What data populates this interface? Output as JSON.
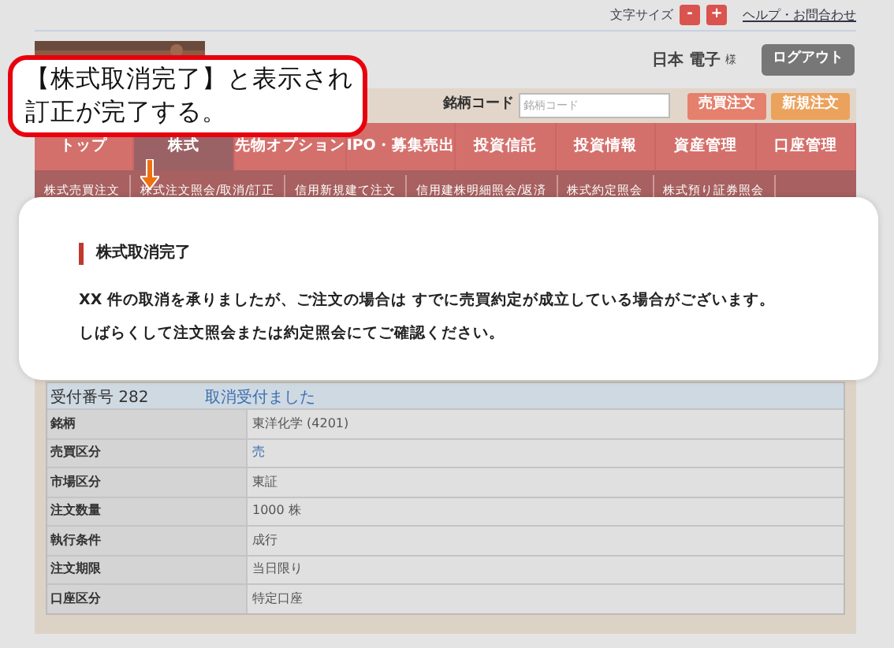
{
  "top_bar": {
    "font_size_label": "文字サイズ",
    "font_buttons": [
      "-",
      "+"
    ],
    "help_link": "ヘルプ・お問合わせ"
  },
  "header": {
    "user_name": "日本 電子",
    "honorific": "様",
    "logout": "ログアウト"
  },
  "search": {
    "label": "銘柄コード",
    "placeholder": "銘柄コード",
    "buttons": [
      {
        "label": "売買注文",
        "color": "#e5806c"
      },
      {
        "label": "新規注文",
        "color": "#eba25c"
      }
    ]
  },
  "nav_tabs": [
    {
      "label": "トップ",
      "selected": false
    },
    {
      "label": "株式",
      "selected": true
    },
    {
      "label": "先物オプション",
      "selected": false
    },
    {
      "label": "IPO・募集売出",
      "selected": false
    },
    {
      "label": "投資信託",
      "selected": false
    },
    {
      "label": "投資情報",
      "selected": false
    },
    {
      "label": "資産管理",
      "selected": false
    },
    {
      "label": "口座管理",
      "selected": false
    }
  ],
  "sub_nav": [
    "株式売買注文",
    "株式注文照会/取消/訂正",
    "信用新規建て注文",
    "信用建株明細照会/返済",
    "株式約定照会",
    "株式預り証券照会"
  ],
  "order_table": {
    "header": {
      "label": "受付番号 282",
      "status": "取消受付ました"
    },
    "rows": [
      {
        "label": "銘柄",
        "value": "東洋化学 (4201)",
        "kind": "plain"
      },
      {
        "label": "売買区分",
        "value": "売",
        "kind": "link"
      },
      {
        "label": "市場区分",
        "value": "東証",
        "kind": "plain"
      },
      {
        "label": "注文数量",
        "value": "1000 株",
        "kind": "plain"
      },
      {
        "label": "執行条件",
        "value": "成行",
        "kind": "plain"
      },
      {
        "label": "注文期限",
        "value": "当日限り",
        "kind": "plain"
      },
      {
        "label": "口座区分",
        "value": "特定口座",
        "kind": "plain"
      }
    ]
  },
  "completion_dialog": {
    "title": "株式取消完了",
    "message_lines": [
      "XX 件の取消を承りましたが、ご注文の場合は すでに売買約定が成立している場合がございます。",
      "しばらくして注文照会または約定照会にてご確認ください。"
    ]
  },
  "callout": {
    "text": "【株式取消完了】と表示され訂正が完了する。"
  }
}
